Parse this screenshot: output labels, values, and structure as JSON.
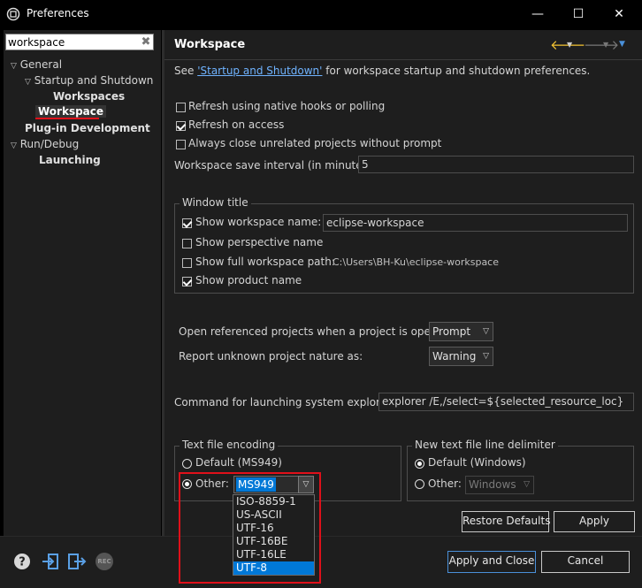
{
  "window": {
    "title": "Preferences",
    "minimize": "—",
    "maximize": "☐",
    "close": "✕"
  },
  "filter": {
    "value": "workspace",
    "clear": "✖"
  },
  "tree": {
    "general": "General",
    "startup": "Startup and Shutdown",
    "workspaces": "Workspaces",
    "workspace": "Workspace",
    "plugin": "Plug-in Development",
    "rundebug": "Run/Debug",
    "launching": "Launching"
  },
  "page": {
    "title": "Workspace",
    "see_prefix": "See ",
    "see_link": "'Startup and Shutdown'",
    "see_suffix": " for workspace startup and shutdown preferences.",
    "refresh_native": "Refresh using native hooks or polling",
    "refresh_access": "Refresh on access",
    "always_close": "Always close unrelated projects without prompt",
    "save_interval_label": "Workspace save interval (in minutes):",
    "save_interval_value": "5",
    "window_title": {
      "group": "Window title",
      "show_name": "Show workspace name:",
      "name_value": "eclipse-workspace",
      "show_perspective": "Show perspective name",
      "show_full_path": "Show full workspace path:",
      "full_path_value": "C:\\Users\\BH-Ku\\eclipse-workspace",
      "show_product": "Show product name"
    },
    "open_ref_label": "Open referenced projects when a project is opened:",
    "open_ref_value": "Prompt",
    "unknown_nature_label": "Report unknown project nature as:",
    "unknown_nature_value": "Warning",
    "explorer_label": "Command for launching system explorer:",
    "explorer_value": "explorer /E,/select=${selected_resource_loc}",
    "encoding": {
      "group": "Text file encoding",
      "default": "Default (MS949)",
      "other": "Other:",
      "other_value": "MS949",
      "options": [
        "ISO-8859-1",
        "US-ASCII",
        "UTF-16",
        "UTF-16BE",
        "UTF-16LE",
        "UTF-8"
      ],
      "selected_option": "UTF-8"
    },
    "delimiter": {
      "group": "New text file line delimiter",
      "default": "Default (Windows)",
      "other": "Other:",
      "other_value": "Windows"
    },
    "restore_defaults": "Restore Defaults",
    "apply": "Apply"
  },
  "footer": {
    "apply_close": "Apply and Close",
    "cancel": "Cancel",
    "rec": "REC"
  },
  "colors": {
    "background": "#1e1e1e",
    "accent": "#0078d7",
    "highlight": "#e0101a",
    "link": "#6fb3ff"
  }
}
